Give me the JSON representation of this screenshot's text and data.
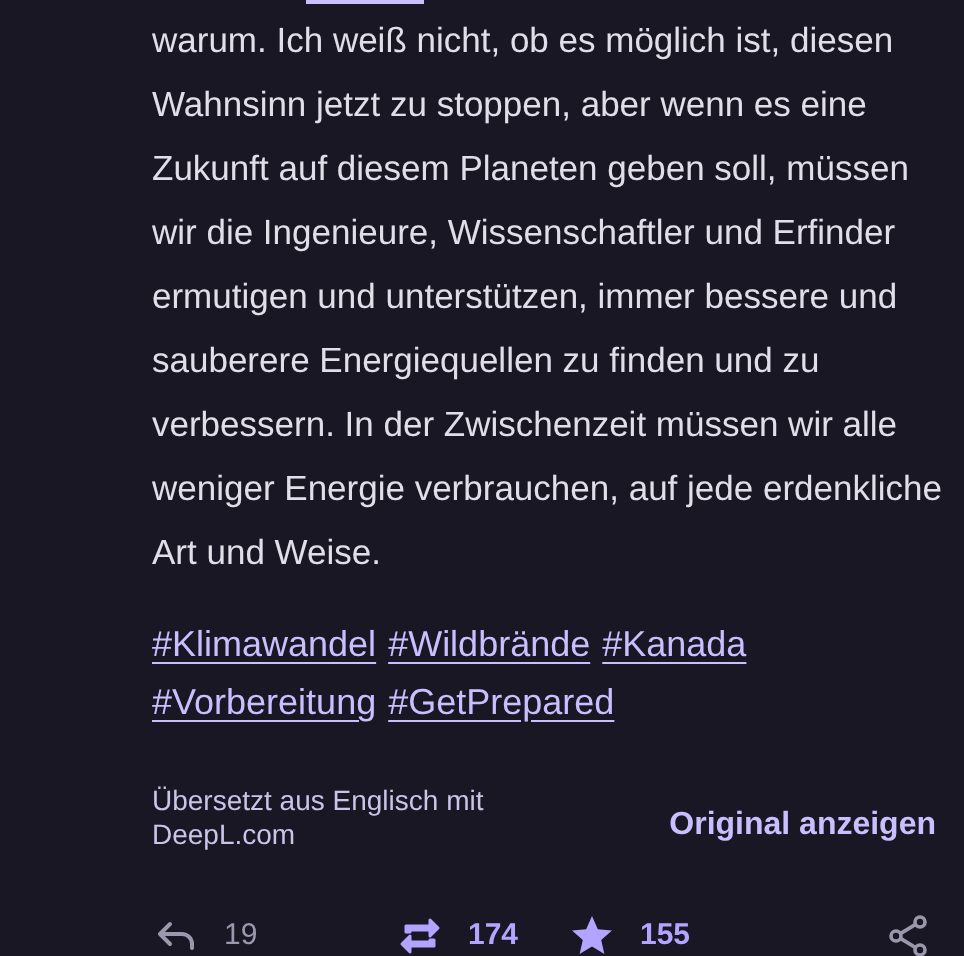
{
  "body": "warum. Ich weiß nicht, ob es möglich ist, diesen Wahnsinn jetzt zu stoppen, aber wenn es eine Zukunft auf diesem Planeten geben soll, müssen wir die Ingenieure, Wissenschaftler und Erfinder ermutigen und unterstützen, immer bessere und sauberere Energiequellen zu finden und zu verbessern. In der Zwischenzeit müssen wir alle weniger Energie verbrauchen, auf jede erdenkliche Art und Weise.",
  "hashtags": [
    "#Klimawandel",
    "#Wildbrände",
    "#Kanada",
    "#Vorbereitung",
    "#GetPrepared"
  ],
  "translation": {
    "note": "Übersetzt aus Englisch mit DeepL.com",
    "link": "Original anzeigen"
  },
  "actions": [
    {
      "kind": "reply",
      "count": "19",
      "active": false
    },
    {
      "kind": "boost",
      "count": "174",
      "active": true
    },
    {
      "kind": "favourite",
      "count": "155",
      "active": true
    },
    {
      "kind": "share",
      "active": false
    }
  ]
}
